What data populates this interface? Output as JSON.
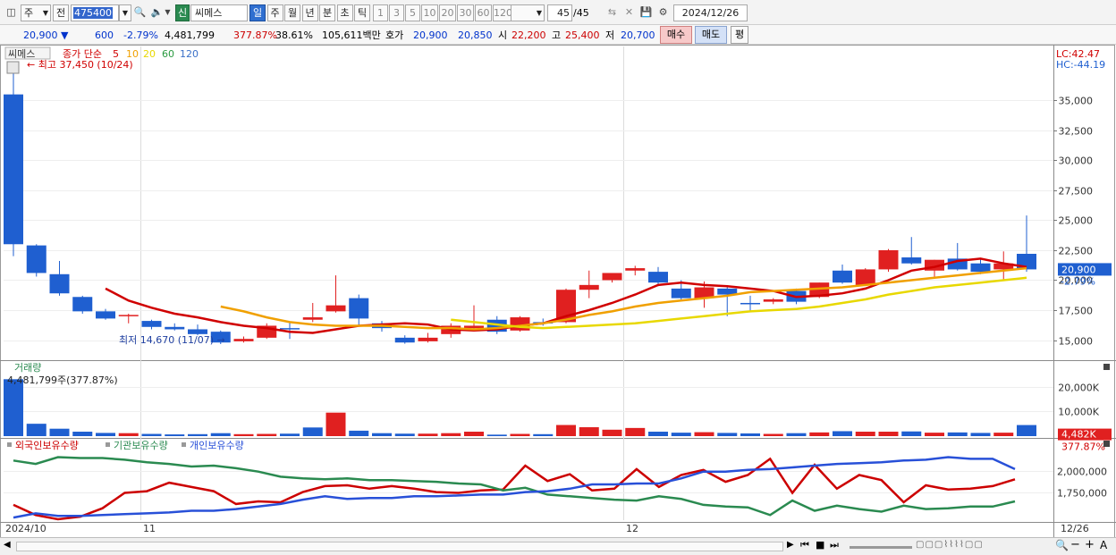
{
  "toolbar": {
    "market_mode": "주",
    "prev_label": "전",
    "code": "475400",
    "type_badge": "신",
    "stock_name": "씨메스",
    "periods": [
      "일",
      "주",
      "월",
      "년",
      "분",
      "초",
      "틱"
    ],
    "active_period": "일",
    "intervals": [
      "1",
      "3",
      "5",
      "10",
      "20",
      "30",
      "60",
      "120"
    ],
    "count": "45",
    "count_total": "/45",
    "date": "2024/12/26"
  },
  "quote": {
    "price": "20,900",
    "change": "600",
    "change_pct": "-2.79%",
    "volume": "4,481,799",
    "volume_pct": "377.87%",
    "turnover_pct": "38.61%",
    "amount": "105,611백만",
    "bid_label": "호가",
    "bid1": "20,900",
    "bid2": "20,850",
    "open_label": "시",
    "open": "22,200",
    "high_label": "고",
    "high": "25,400",
    "low_label": "저",
    "low": "20,700",
    "buy_label": "매수",
    "sell_label": "매도",
    "eval_label": "평"
  },
  "price_panel": {
    "title_name": "씨메스",
    "legend_prefix": "종가 단순",
    "ma_labels": [
      "5",
      "10",
      "20",
      "60",
      "120"
    ],
    "ma_colors": [
      "#d00000",
      "#f0a000",
      "#e8d800",
      "#2a9a40",
      "#3a70c8"
    ],
    "lc_label": "LC:42.47",
    "hc_label": "HC:-44.19",
    "max_label": "최고 37,450 (10/24)",
    "min_label": "최저 14,670 (11/07)",
    "last_price_tag": "20,900",
    "last_change_tag": "-2.79%"
  },
  "volume_panel": {
    "title": "거래량",
    "value_label": "4,481,799주(377.87%)",
    "tag_value": "4,482K",
    "tag_pct": "377.87%"
  },
  "holding_panel": {
    "legend": [
      {
        "name": "외국인보유수량",
        "color": "#cc0000"
      },
      {
        "name": "기관보유수량",
        "color": "#2a8a50"
      },
      {
        "name": "개인보유수량",
        "color": "#2850d8"
      }
    ]
  },
  "x_axis": {
    "labels": [
      {
        "text": "2024/10",
        "index": 0
      },
      {
        "text": "11",
        "index": 6
      },
      {
        "text": "12",
        "index": 27
      },
      {
        "text": "12/26",
        "index": 47
      }
    ]
  },
  "chart_data": [
    {
      "type": "candlestick",
      "title": "씨메스",
      "ylim": [
        13400,
        39500
      ],
      "yticks": [
        15000,
        17500,
        20000,
        22500,
        25000,
        27500,
        30000,
        32500,
        35000
      ],
      "ytick_labels": [
        "15,000",
        "17,500",
        "20,000",
        "22,500",
        "25,000",
        "27,500",
        "30,000",
        "32,500",
        "35,000"
      ],
      "candles": [
        {
          "o": 35500,
          "h": 37450,
          "l": 22000,
          "c": 23000
        },
        {
          "o": 22900,
          "h": 23000,
          "l": 20300,
          "c": 20600
        },
        {
          "o": 20500,
          "h": 21600,
          "l": 18700,
          "c": 18900
        },
        {
          "o": 18600,
          "h": 18700,
          "l": 17200,
          "c": 17400
        },
        {
          "o": 17400,
          "h": 17600,
          "l": 16700,
          "c": 16800
        },
        {
          "o": 17000,
          "h": 17200,
          "l": 16400,
          "c": 17100
        },
        {
          "o": 16600,
          "h": 16700,
          "l": 15900,
          "c": 16100
        },
        {
          "o": 16100,
          "h": 16400,
          "l": 15800,
          "c": 15900
        },
        {
          "o": 15900,
          "h": 16300,
          "l": 15400,
          "c": 15500
        },
        {
          "o": 15700,
          "h": 15800,
          "l": 14670,
          "c": 14800
        },
        {
          "o": 14900,
          "h": 15300,
          "l": 14800,
          "c": 15100
        },
        {
          "o": 15200,
          "h": 16400,
          "l": 15100,
          "c": 16200
        },
        {
          "o": 16000,
          "h": 16500,
          "l": 15100,
          "c": 15900
        },
        {
          "o": 16700,
          "h": 18100,
          "l": 16500,
          "c": 16900
        },
        {
          "o": 17400,
          "h": 20400,
          "l": 17300,
          "c": 17900
        },
        {
          "o": 18500,
          "h": 18800,
          "l": 16200,
          "c": 16800
        },
        {
          "o": 16400,
          "h": 16600,
          "l": 15700,
          "c": 16000
        },
        {
          "o": 15200,
          "h": 15400,
          "l": 14700,
          "c": 14800
        },
        {
          "o": 14900,
          "h": 15600,
          "l": 14800,
          "c": 15200
        },
        {
          "o": 15500,
          "h": 16400,
          "l": 15200,
          "c": 16200
        },
        {
          "o": 16000,
          "h": 17900,
          "l": 15800,
          "c": 16200
        },
        {
          "o": 16700,
          "h": 17000,
          "l": 15500,
          "c": 15700
        },
        {
          "o": 15800,
          "h": 17000,
          "l": 15700,
          "c": 16900
        },
        {
          "o": 16500,
          "h": 16800,
          "l": 16200,
          "c": 16400
        },
        {
          "o": 16500,
          "h": 19300,
          "l": 16400,
          "c": 19200
        },
        {
          "o": 19200,
          "h": 20800,
          "l": 18500,
          "c": 19600
        },
        {
          "o": 20000,
          "h": 20600,
          "l": 19800,
          "c": 20600
        },
        {
          "o": 20800,
          "h": 21200,
          "l": 20400,
          "c": 21000
        },
        {
          "o": 20700,
          "h": 21100,
          "l": 19500,
          "c": 19800
        },
        {
          "o": 19300,
          "h": 20000,
          "l": 18300,
          "c": 18500
        },
        {
          "o": 18500,
          "h": 19900,
          "l": 17700,
          "c": 19400
        },
        {
          "o": 19300,
          "h": 19500,
          "l": 17000,
          "c": 18800
        },
        {
          "o": 18100,
          "h": 18700,
          "l": 17400,
          "c": 18000
        },
        {
          "o": 18200,
          "h": 18500,
          "l": 18000,
          "c": 18400
        },
        {
          "o": 19100,
          "h": 19300,
          "l": 18000,
          "c": 18200
        },
        {
          "o": 18600,
          "h": 19800,
          "l": 18500,
          "c": 19800
        },
        {
          "o": 20800,
          "h": 21300,
          "l": 19700,
          "c": 19800
        },
        {
          "o": 19600,
          "h": 21000,
          "l": 19600,
          "c": 20900
        },
        {
          "o": 20900,
          "h": 22600,
          "l": 20700,
          "c": 22500
        },
        {
          "o": 21900,
          "h": 23600,
          "l": 21300,
          "c": 21400
        },
        {
          "o": 20800,
          "h": 21700,
          "l": 20300,
          "c": 21700
        },
        {
          "o": 21800,
          "h": 23100,
          "l": 20800,
          "c": 20900
        },
        {
          "o": 21400,
          "h": 21800,
          "l": 20500,
          "c": 20700
        },
        {
          "o": 20900,
          "h": 22400,
          "l": 20000,
          "c": 21400
        },
        {
          "o": 22200,
          "h": 25400,
          "l": 20700,
          "c": 20900
        }
      ],
      "moving_averages": [
        {
          "period": "5",
          "color": "#d00000",
          "values": [
            null,
            null,
            null,
            null,
            19300,
            18300,
            17700,
            17200,
            16900,
            16500,
            16200,
            16000,
            15700,
            15600,
            15900,
            16200,
            16300,
            16400,
            16300,
            15900,
            15800,
            15900,
            16200,
            16400,
            17000,
            17500,
            18100,
            18800,
            19600,
            19800,
            19600,
            19500,
            19300,
            19100,
            18600,
            18700,
            18900,
            19300,
            20000,
            20800,
            21100,
            21600,
            21800,
            21400,
            21100
          ]
        },
        {
          "period": "10",
          "color": "#f0a000",
          "values": [
            null,
            null,
            null,
            null,
            null,
            null,
            null,
            null,
            null,
            17800,
            17400,
            16900,
            16500,
            16300,
            16200,
            16200,
            16200,
            16100,
            16000,
            16000,
            15900,
            16000,
            16200,
            16400,
            16700,
            17100,
            17400,
            17800,
            18100,
            18300,
            18500,
            18700,
            19000,
            19100,
            19200,
            19300,
            19400,
            19600,
            19800,
            20000,
            20200,
            20400,
            20600,
            20800,
            21000
          ]
        },
        {
          "period": "20",
          "color": "#e8d800",
          "values": [
            null,
            null,
            null,
            null,
            null,
            null,
            null,
            null,
            null,
            null,
            null,
            null,
            null,
            null,
            null,
            null,
            null,
            null,
            null,
            16700,
            16500,
            16300,
            16100,
            16000,
            16100,
            16200,
            16300,
            16400,
            16600,
            16800,
            17000,
            17200,
            17400,
            17500,
            17600,
            17800,
            18100,
            18400,
            18800,
            19100,
            19400,
            19600,
            19800,
            20000,
            20200
          ]
        }
      ]
    },
    {
      "type": "bar",
      "title": "거래량",
      "ylim": [
        0,
        26000
      ],
      "yticks": [
        10000,
        20000
      ],
      "ytick_labels": [
        "10,000K",
        "20,000K"
      ],
      "unit": "K",
      "values": [
        23000,
        5000,
        3000,
        1800,
        1300,
        1200,
        900,
        700,
        800,
        1200,
        800,
        900,
        1000,
        3500,
        9500,
        2200,
        1200,
        1000,
        1000,
        1200,
        1800,
        600,
        900,
        800,
        4500,
        3600,
        2600,
        3300,
        1800,
        1400,
        1600,
        1300,
        1100,
        900,
        1200,
        1500,
        2000,
        1800,
        1800,
        1900,
        1400,
        1500,
        1300,
        1400,
        4482
      ],
      "up": [
        false,
        false,
        false,
        false,
        false,
        true,
        false,
        false,
        false,
        false,
        true,
        true,
        false,
        false,
        true,
        false,
        false,
        false,
        true,
        true,
        true,
        false,
        true,
        false,
        true,
        true,
        true,
        true,
        false,
        false,
        true,
        false,
        false,
        true,
        false,
        true,
        false,
        true,
        true,
        false,
        true,
        false,
        false,
        true,
        false
      ]
    },
    {
      "type": "line",
      "title": "외국인보유수량 / 기관보유수량 / 개인보유수량",
      "ylim": [
        1420000,
        2260000
      ],
      "yticks": [
        1750000,
        2000000
      ],
      "ytick_labels": [
        "1,750,000",
        "2,000,000"
      ],
      "series": [
        {
          "name": "외국인보유수량",
          "color": "#cc0000",
          "values": [
            1600000,
            1480000,
            1430000,
            1460000,
            1560000,
            1740000,
            1760000,
            1860000,
            1810000,
            1760000,
            1610000,
            1640000,
            1630000,
            1750000,
            1820000,
            1830000,
            1790000,
            1820000,
            1790000,
            1750000,
            1740000,
            1770000,
            1780000,
            2060000,
            1880000,
            1960000,
            1770000,
            1790000,
            2020000,
            1810000,
            1950000,
            2010000,
            1870000,
            1950000,
            2140000,
            1740000,
            2070000,
            1790000,
            1950000,
            1890000,
            1630000,
            1830000,
            1780000,
            1790000,
            1820000,
            1900000
          ]
        },
        {
          "name": "기관보유수량",
          "color": "#2a8a50",
          "values": [
            2120000,
            2080000,
            2160000,
            2150000,
            2150000,
            2130000,
            2100000,
            2080000,
            2050000,
            2060000,
            2030000,
            1990000,
            1930000,
            1910000,
            1900000,
            1910000,
            1890000,
            1890000,
            1880000,
            1870000,
            1850000,
            1840000,
            1770000,
            1800000,
            1720000,
            1700000,
            1680000,
            1660000,
            1650000,
            1700000,
            1670000,
            1600000,
            1580000,
            1570000,
            1480000,
            1650000,
            1530000,
            1590000,
            1550000,
            1520000,
            1590000,
            1550000,
            1560000,
            1580000,
            1580000,
            1640000
          ]
        },
        {
          "name": "개인보유수량",
          "color": "#2850d8",
          "values": [
            1450000,
            1500000,
            1470000,
            1470000,
            1480000,
            1490000,
            1500000,
            1510000,
            1530000,
            1530000,
            1550000,
            1580000,
            1610000,
            1660000,
            1700000,
            1670000,
            1680000,
            1680000,
            1700000,
            1700000,
            1710000,
            1720000,
            1720000,
            1750000,
            1760000,
            1790000,
            1840000,
            1840000,
            1850000,
            1850000,
            1910000,
            1990000,
            1990000,
            2010000,
            2020000,
            2040000,
            2060000,
            2080000,
            2090000,
            2100000,
            2120000,
            2130000,
            2160000,
            2140000,
            2140000,
            2020000
          ]
        }
      ]
    }
  ]
}
